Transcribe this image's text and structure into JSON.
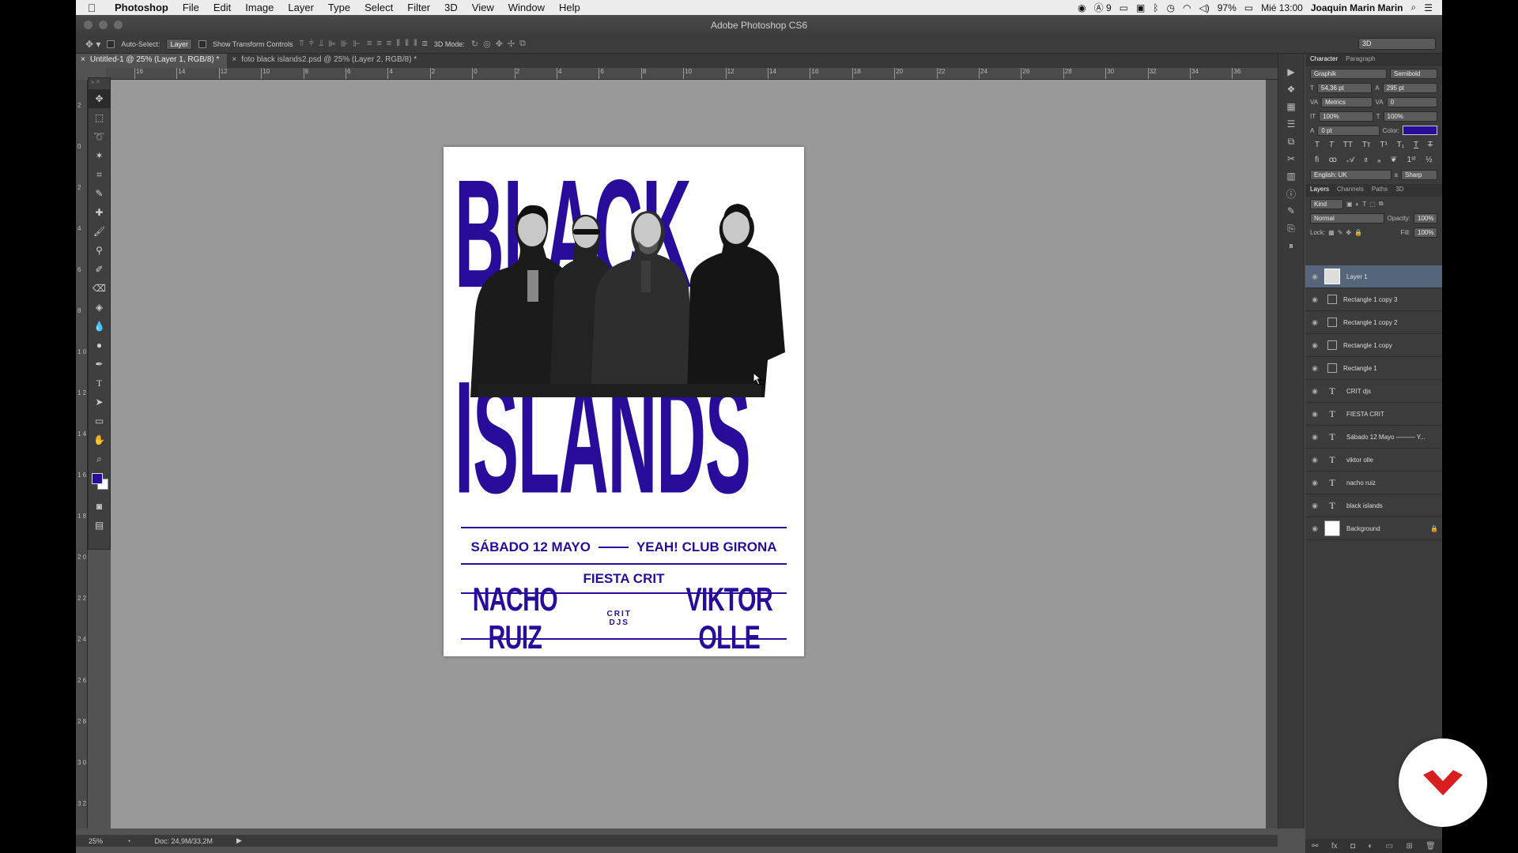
{
  "menubar": {
    "apple": "",
    "items": [
      "Photoshop",
      "File",
      "Edit",
      "Image",
      "Layer",
      "Type",
      "Select",
      "Filter",
      "3D",
      "View",
      "Window",
      "Help"
    ],
    "status": {
      "adobe_count": "9",
      "battery": "97%",
      "clock": "Mié 13:00",
      "user": "Joaquin Marin Marin"
    }
  },
  "window": {
    "title": "Adobe Photoshop CS6"
  },
  "options": {
    "auto_select_label": "Auto-Select:",
    "auto_select_value": "Layer",
    "transform_label": "Show Transform Controls",
    "mode_label": "3D Mode:",
    "workspace": "3D"
  },
  "tabs": [
    {
      "label": "Untitled-1 @ 25% (Layer 1, RGB/8) *"
    },
    {
      "label": "foto black islands2.psd @ 25% (Layer 2, RGB/8) *"
    }
  ],
  "poster": {
    "word_top": "BLACK",
    "word_bottom": "ISLANDS",
    "date": "SÁBADO 12 MAYO",
    "venue": "YEAH! CLUB GIRONA",
    "event": "FIESTA CRIT",
    "dj_left": "NACHO RUIZ",
    "dj_middle": "CRIT DJS",
    "dj_right": "VIKTOR OLLE",
    "brand_color": "#2a0c9a"
  },
  "character": {
    "tabs": [
      "Character",
      "Paragraph"
    ],
    "font_family": "Graphik",
    "font_style": "Semibold",
    "font_size": "54,36 pt",
    "leading": "295 pt",
    "kerning": "Metrics",
    "tracking": "0",
    "vscale": "100%",
    "hscale": "100%",
    "baseline": "0 pt",
    "color_label": "Color:",
    "color": "#2a0c9a",
    "language": "English: UK",
    "aa_label": "a",
    "antialias": "Sharp"
  },
  "layers_panel": {
    "tabs": [
      "Layers",
      "Channels",
      "Paths",
      "3D"
    ],
    "filter": "Kind",
    "blend": "Normal",
    "opacity_label": "Opacity:",
    "opacity": "100%",
    "lock_label": "Lock:",
    "fill_label": "Fill:",
    "fill": "100%",
    "layers": [
      {
        "name": "Layer 1",
        "kind": "image",
        "selected": true
      },
      {
        "name": "Rectangle 1 copy 3",
        "kind": "shape"
      },
      {
        "name": "Rectangle 1 copy 2",
        "kind": "shape"
      },
      {
        "name": "Rectangle 1 copy",
        "kind": "shape"
      },
      {
        "name": "Rectangle 1",
        "kind": "shape"
      },
      {
        "name": "CRIT djs",
        "kind": "text"
      },
      {
        "name": "FIESTA CRIT",
        "kind": "text"
      },
      {
        "name": "Sábado 12 Mayo  ——— Y...",
        "kind": "text"
      },
      {
        "name": "viktor olle",
        "kind": "text"
      },
      {
        "name": "nacho ruiz",
        "kind": "text"
      },
      {
        "name": "black islands",
        "kind": "text"
      },
      {
        "name": "Background",
        "kind": "background"
      }
    ]
  },
  "status": {
    "zoom": "25%",
    "doc": "Doc: 24,9M/33,2M"
  },
  "ruler": {
    "top": [
      "16",
      "14",
      "12",
      "10",
      "8",
      "6",
      "4",
      "2",
      "0",
      "2",
      "4",
      "6",
      "8",
      "10",
      "12",
      "14",
      "16",
      "18",
      "20",
      "22",
      "24",
      "26",
      "28",
      "30",
      "32",
      "34",
      "36"
    ],
    "left": [
      "2",
      "0",
      "2",
      "4",
      "6",
      "8",
      "1 0",
      "1 2",
      "1 4",
      "1 6",
      "1 8",
      "2 0",
      "2 2",
      "2 4",
      "2 6",
      "2 8",
      "3 0",
      "3 2"
    ]
  }
}
